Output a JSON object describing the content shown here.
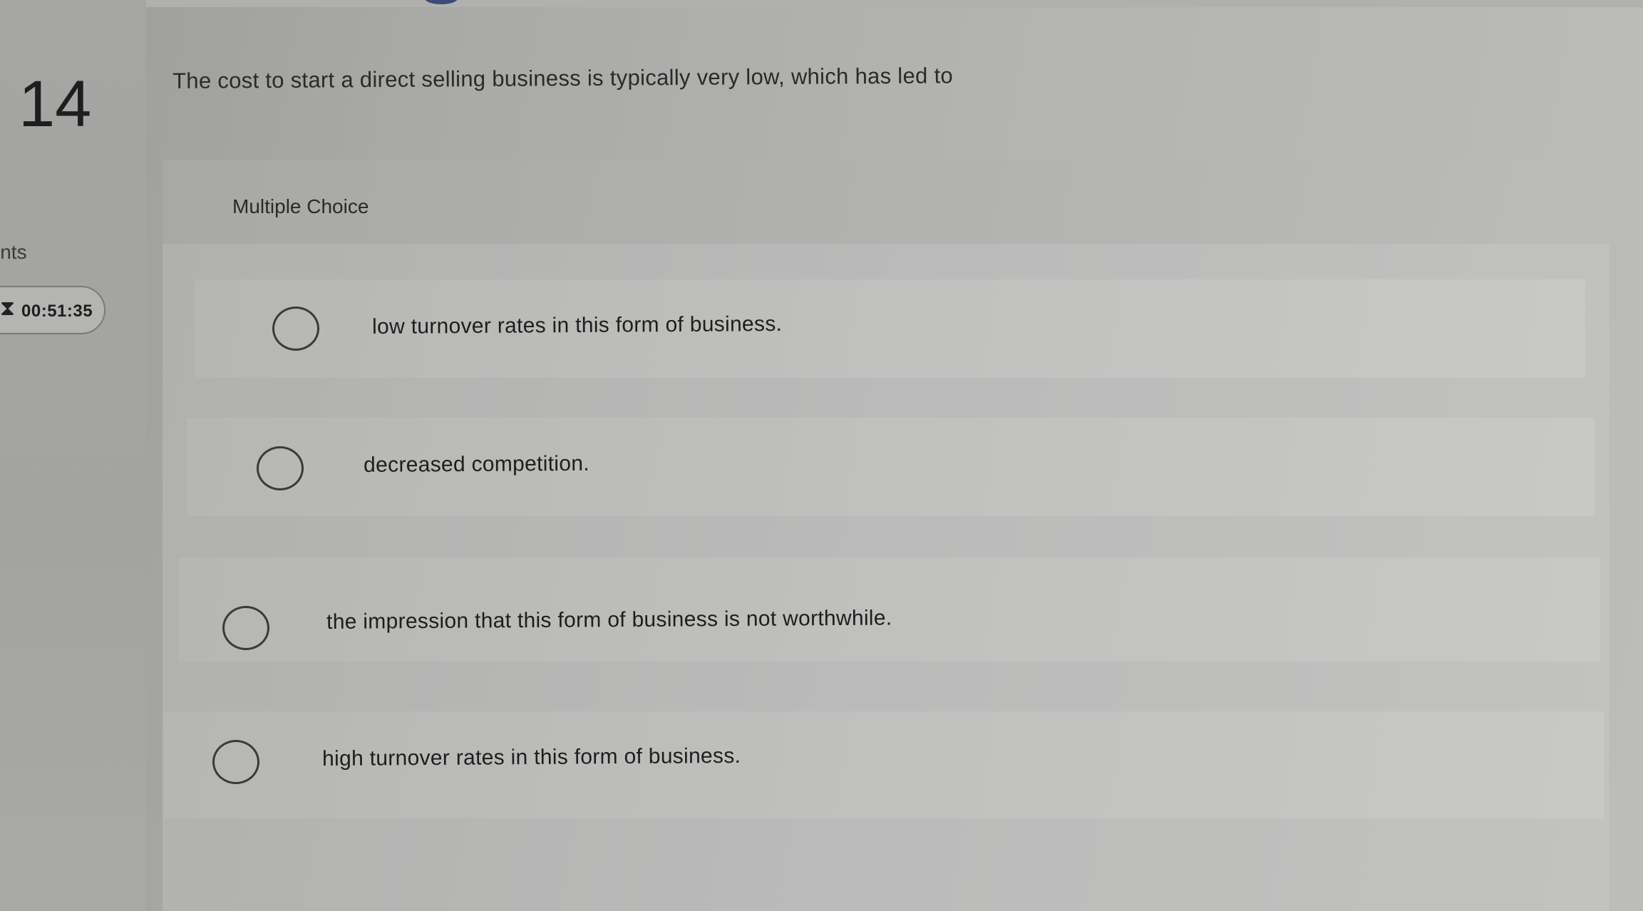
{
  "question": {
    "number": "14",
    "text": "The cost to start a direct selling business is typically very low, which has led to"
  },
  "sidebar": {
    "points_label": "ints",
    "timer": {
      "icon": "hourglass-icon",
      "value": "00:51:35"
    }
  },
  "multiple_choice": {
    "label": "Multiple Choice",
    "options": [
      {
        "text": "low turnover rates in this form of business.",
        "selected": false
      },
      {
        "text": "decreased competition.",
        "selected": false
      },
      {
        "text": "the impression that this form of business is not worthwhile.",
        "selected": false
      },
      {
        "text": "high turnover rates in this form of business.",
        "selected": false
      }
    ]
  }
}
